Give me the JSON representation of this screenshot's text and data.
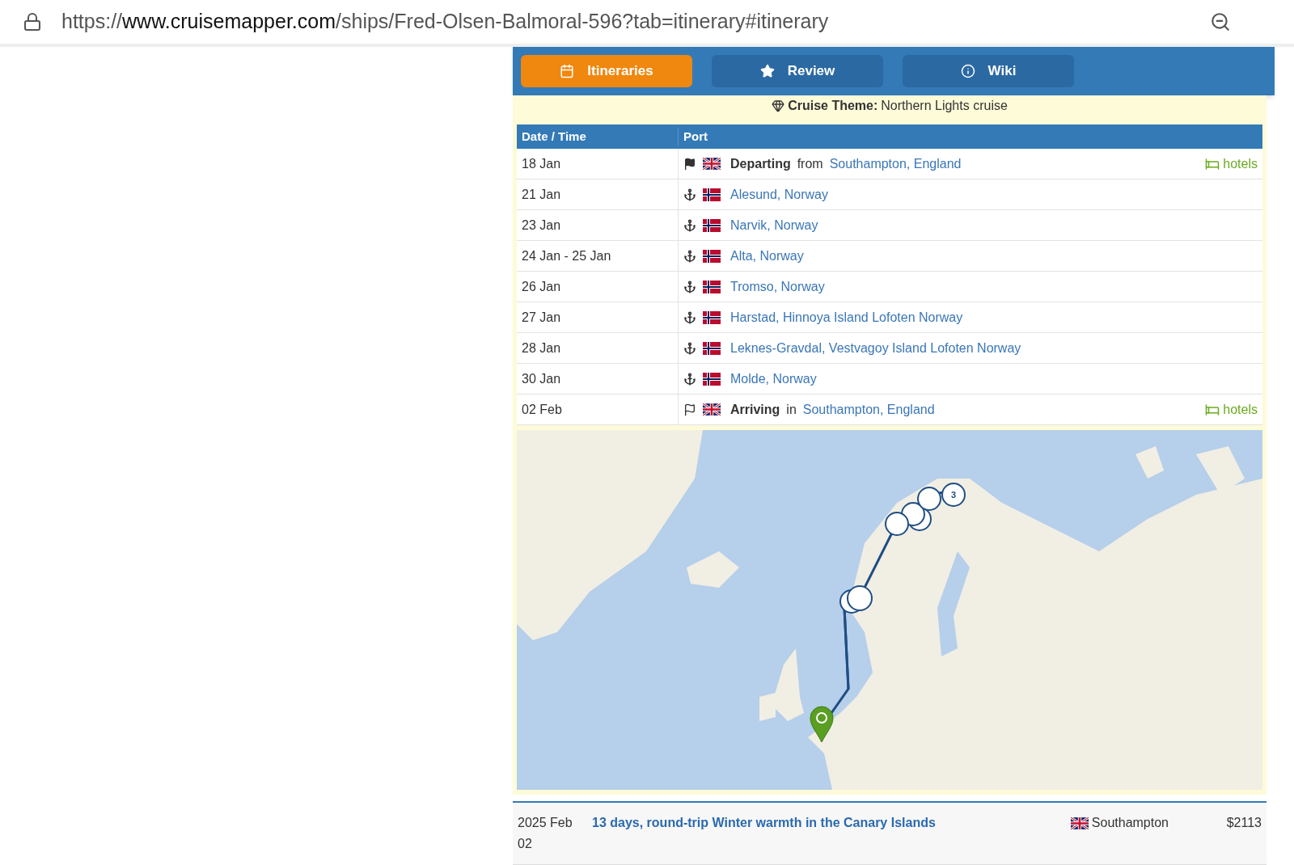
{
  "address_bar": {
    "scheme": "https://",
    "host": "www.cruisemapper.com",
    "path": "/ships/Fred-Olsen-Balmoral-596?tab=itinerary#itinerary"
  },
  "tabs": [
    {
      "label": "Itineraries",
      "selected": true
    },
    {
      "label": "Review",
      "selected": false
    },
    {
      "label": "Wiki",
      "selected": false
    }
  ],
  "theme": {
    "label": "Cruise Theme:",
    "value": "Northern Lights cruise"
  },
  "table": {
    "columns": [
      "Date / Time",
      "Port"
    ],
    "rows": [
      {
        "date": "18 Jan",
        "kind": "depart",
        "verb": "Departing",
        "prep": "from",
        "port": "Southampton, England",
        "hotels": "hotels"
      },
      {
        "date": "21 Jan",
        "kind": "call",
        "port": "Alesund, Norway"
      },
      {
        "date": "23 Jan",
        "kind": "call",
        "port": "Narvik, Norway"
      },
      {
        "date": "24 Jan - 25 Jan",
        "kind": "call",
        "port": "Alta, Norway"
      },
      {
        "date": "26 Jan",
        "kind": "call",
        "port": "Tromso, Norway"
      },
      {
        "date": "27 Jan",
        "kind": "call",
        "port": "Harstad, Hinnoya Island Lofoten Norway"
      },
      {
        "date": "28 Jan",
        "kind": "call",
        "port": "Leknes-Gravdal, Vestvagoy Island Lofoten Norway"
      },
      {
        "date": "30 Jan",
        "kind": "call",
        "port": "Molde, Norway"
      },
      {
        "date": "02 Feb",
        "kind": "arrive",
        "verb": "Arriving",
        "prep": "in",
        "port": "Southampton, England",
        "hotels": "hotels"
      }
    ]
  },
  "map": {
    "marker_label": "3"
  },
  "next_cruise": {
    "date": "2025 Feb 02",
    "title": "13 days, round-trip Winter warmth in the Canary Islands",
    "port": "Southampton",
    "price": "$2113"
  }
}
